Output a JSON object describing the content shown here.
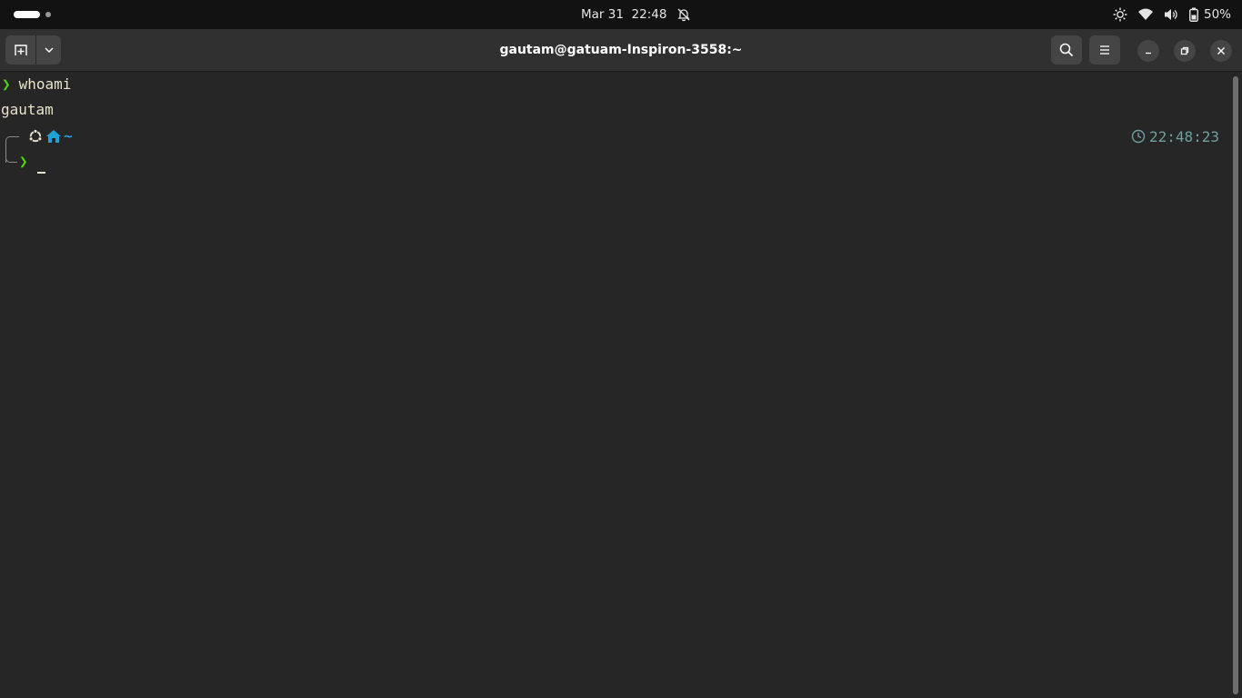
{
  "topbar": {
    "date": "Mar 31",
    "time": "22:48",
    "battery_percent": "50%",
    "icons": [
      "bell-off-icon",
      "brightness-icon",
      "wifi-icon",
      "volume-icon",
      "battery-icon"
    ]
  },
  "window": {
    "title": "gautam@gatuam-Inspiron-3558:~"
  },
  "terminal": {
    "prompt_symbol": "❯",
    "command": "whoami",
    "output": "gautam",
    "path": "~",
    "second_prompt_symbol": "❯",
    "timestamp": "22:48:23"
  },
  "colors": {
    "terminal_bg": "#262626",
    "prompt_green": "#4fd40d",
    "path_blue": "#1fa2d3",
    "text": "#e9e3c9",
    "timestamp": "#6f9fa0"
  }
}
